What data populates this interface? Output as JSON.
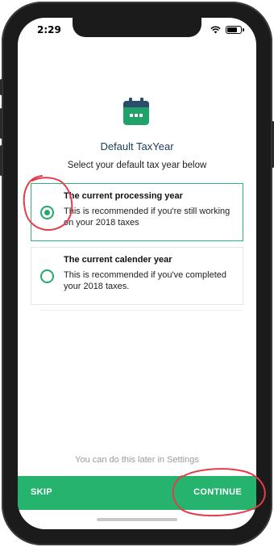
{
  "status_bar": {
    "time": "2:29"
  },
  "header": {
    "icon": "calendar-icon",
    "title": "Default TaxYear",
    "subtitle": "Select your default tax year below"
  },
  "options": [
    {
      "title": "The current processing year",
      "description": "This is recommended if you're still working on your 2018 taxes",
      "selected": true
    },
    {
      "title": "The current calender year",
      "description": "This is recommended if you've completed your 2018 taxes.",
      "selected": false
    }
  ],
  "footer": {
    "later_text": "You can do this later in Settings",
    "skip_label": "SKIP",
    "continue_label": "CONTINUE"
  },
  "colors": {
    "accent": "#25b36e",
    "title": "#1a3b5a",
    "annotation": "#e53b4b"
  },
  "battery_level": 0.8
}
